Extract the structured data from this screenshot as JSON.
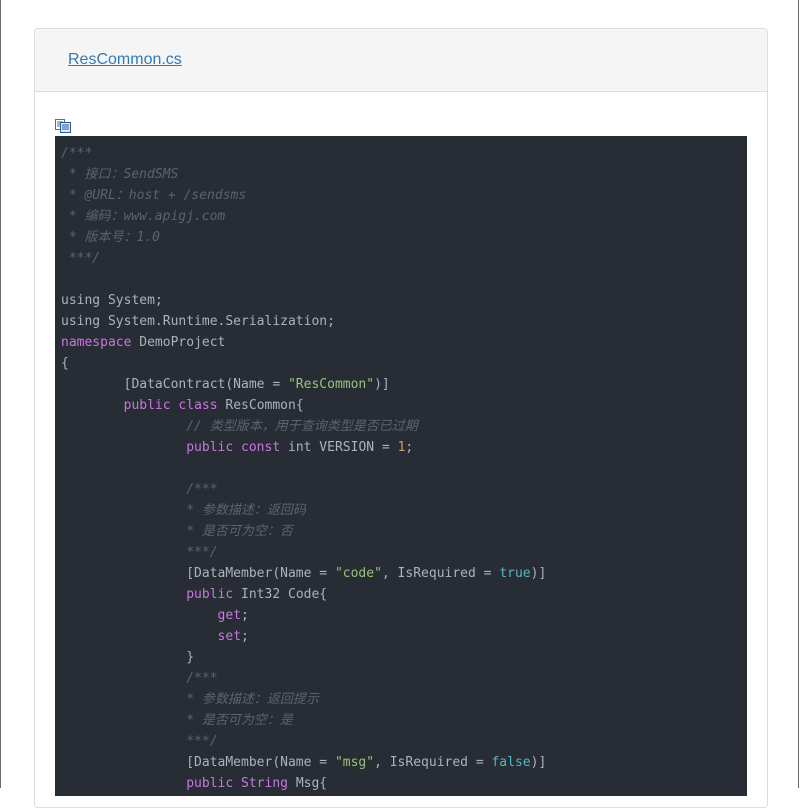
{
  "file": {
    "name": "ResCommon.cs"
  },
  "icons": {
    "copy": "copy-icon"
  },
  "colors": {
    "code_bg": "#282c34",
    "code_text": "#abb2bf",
    "comment": "#5c6370",
    "keyword": "#c678dd",
    "string": "#98c379",
    "number": "#d19a66",
    "literal": "#56b6c2",
    "link": "#337ab7"
  },
  "code": [
    [
      [
        "c",
        "/***"
      ]
    ],
    [
      [
        "c",
        " * 接口：SendSMS"
      ]
    ],
    [
      [
        "c",
        " * @URL：host + /sendsms"
      ]
    ],
    [
      [
        "c",
        " * 编码：www.apigj.com"
      ]
    ],
    [
      [
        "c",
        " * 版本号：1.0"
      ]
    ],
    [
      [
        "c",
        " ***/"
      ]
    ],
    [],
    [
      [
        "p",
        "using System;"
      ]
    ],
    [
      [
        "p",
        "using System.Runtime.Serialization;"
      ]
    ],
    [
      [
        "k",
        "namespace"
      ],
      [
        "p",
        " DemoProject"
      ]
    ],
    [
      [
        "p",
        "{"
      ]
    ],
    [
      [
        "p",
        "        [DataContract(Name = "
      ],
      [
        "s",
        "\"ResCommon\""
      ],
      [
        "p",
        ")]"
      ]
    ],
    [
      [
        "p",
        "        "
      ],
      [
        "k",
        "public"
      ],
      [
        "p",
        " "
      ],
      [
        "k",
        "class"
      ],
      [
        "p",
        " ResCommon{"
      ]
    ],
    [
      [
        "p",
        "                "
      ],
      [
        "c",
        "// 类型版本，用于查询类型是否已过期"
      ]
    ],
    [
      [
        "p",
        "                "
      ],
      [
        "k",
        "public"
      ],
      [
        "p",
        " "
      ],
      [
        "k",
        "const"
      ],
      [
        "p",
        " int VERSION = "
      ],
      [
        "n",
        "1"
      ],
      [
        "p",
        ";"
      ]
    ],
    [],
    [
      [
        "p",
        "                "
      ],
      [
        "c",
        "/***"
      ]
    ],
    [
      [
        "p",
        "                "
      ],
      [
        "c",
        "* 参数描述：返回码"
      ]
    ],
    [
      [
        "p",
        "                "
      ],
      [
        "c",
        "* 是否可为空：否"
      ]
    ],
    [
      [
        "p",
        "                "
      ],
      [
        "c",
        "***/"
      ]
    ],
    [
      [
        "p",
        "                [DataMember(Name = "
      ],
      [
        "s",
        "\"code\""
      ],
      [
        "p",
        ", IsRequired = "
      ],
      [
        "b",
        "true"
      ],
      [
        "p",
        ")]"
      ]
    ],
    [
      [
        "p",
        "                "
      ],
      [
        "k",
        "public"
      ],
      [
        "p",
        " Int32 Code{"
      ]
    ],
    [
      [
        "p",
        "                    "
      ],
      [
        "k",
        "get"
      ],
      [
        "p",
        ";"
      ]
    ],
    [
      [
        "p",
        "                    "
      ],
      [
        "k",
        "set"
      ],
      [
        "p",
        ";"
      ]
    ],
    [
      [
        "p",
        "                }"
      ]
    ],
    [
      [
        "p",
        "                "
      ],
      [
        "c",
        "/***"
      ]
    ],
    [
      [
        "p",
        "                "
      ],
      [
        "c",
        "* 参数描述：返回提示"
      ]
    ],
    [
      [
        "p",
        "                "
      ],
      [
        "c",
        "* 是否可为空：是"
      ]
    ],
    [
      [
        "p",
        "                "
      ],
      [
        "c",
        "***/"
      ]
    ],
    [
      [
        "p",
        "                [DataMember(Name = "
      ],
      [
        "s",
        "\"msg\""
      ],
      [
        "p",
        ", IsRequired = "
      ],
      [
        "b",
        "false"
      ],
      [
        "p",
        ")]"
      ]
    ],
    [
      [
        "p",
        "                "
      ],
      [
        "k",
        "public"
      ],
      [
        "p",
        " "
      ],
      [
        "k",
        "String"
      ],
      [
        "p",
        " Msg{"
      ]
    ]
  ]
}
